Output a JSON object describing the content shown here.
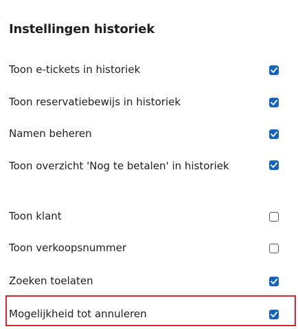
{
  "section": {
    "title": "Instellingen historiek"
  },
  "settings": [
    {
      "label": "Toon e-tickets in historiek",
      "checked": true
    },
    {
      "label": "Toon reservatiebewijs in historiek",
      "checked": true
    },
    {
      "label": "Namen beheren",
      "checked": true
    },
    {
      "label": "Toon overzicht 'Nog te betalen' in historiek",
      "checked": true
    },
    {
      "label": "Toon klant",
      "checked": false
    },
    {
      "label": "Toon verkoopsnummer",
      "checked": false
    },
    {
      "label": "Zoeken toelaten",
      "checked": true
    },
    {
      "label": "Mogelijkheid tot annuleren",
      "checked": true,
      "highlighted": true
    }
  ],
  "colors": {
    "checkbox_checked": "#1565c0",
    "highlight_border": "#d9262e"
  }
}
